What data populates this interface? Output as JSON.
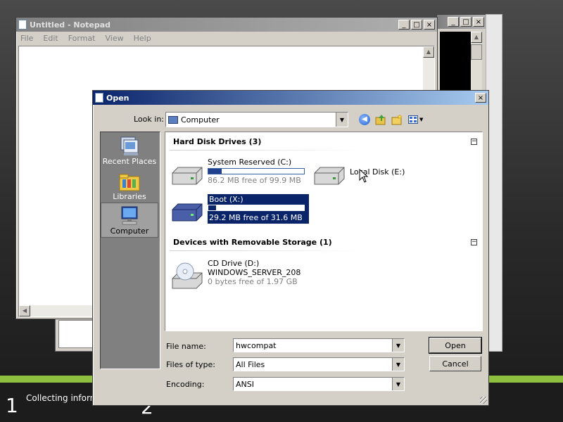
{
  "setup": {
    "step1_num": "1",
    "step1_text": "Collecting inform",
    "step2_num": "2"
  },
  "notepad": {
    "title": "Untitled - Notepad",
    "menus": [
      "File",
      "Edit",
      "Format",
      "View",
      "Help"
    ],
    "caption_buttons": {
      "min": "_",
      "max": "□",
      "close": "×"
    }
  },
  "background_window": {
    "caption_buttons": {
      "min": "_",
      "max": "□",
      "close": "×"
    }
  },
  "dialog": {
    "title": "Open",
    "close_label": "×",
    "look_in_label": "Look in:",
    "look_in_value": "Computer",
    "toolbar_icons": [
      "back-icon",
      "up-folder-icon",
      "new-folder-icon",
      "view-menu-icon"
    ],
    "places": [
      {
        "label": "Recent Places",
        "icon": "recent-places-icon"
      },
      {
        "label": "Libraries",
        "icon": "libraries-icon"
      },
      {
        "label": "Computer",
        "icon": "computer-icon"
      }
    ],
    "groups": [
      {
        "title": "Hard Disk Drives (3)",
        "collapse": "−",
        "drives": [
          {
            "name": "System Reserved (C:)",
            "free": "86.2 MB free of 99.9 MB",
            "used_fraction": 0.14
          },
          {
            "name": "Local Disk (E:)"
          },
          {
            "name": "Boot (X:)",
            "free": "29.2 MB free of 31.6 MB",
            "used_fraction": 0.08
          }
        ]
      },
      {
        "title": "Devices with Removable Storage (1)",
        "collapse": "−",
        "drives": [
          {
            "name": "CD Drive (D:)",
            "label": "WINDOWS_SERVER_208",
            "free": "0 bytes free of 1.97 GB"
          }
        ]
      }
    ],
    "file_name_label": "File name:",
    "file_name_value": "hwcompat",
    "files_of_type_label": "Files of type:",
    "files_of_type_value": "All Files",
    "encoding_label": "Encoding:",
    "encoding_value": "ANSI",
    "open_button": "Open",
    "cancel_button": "Cancel"
  }
}
